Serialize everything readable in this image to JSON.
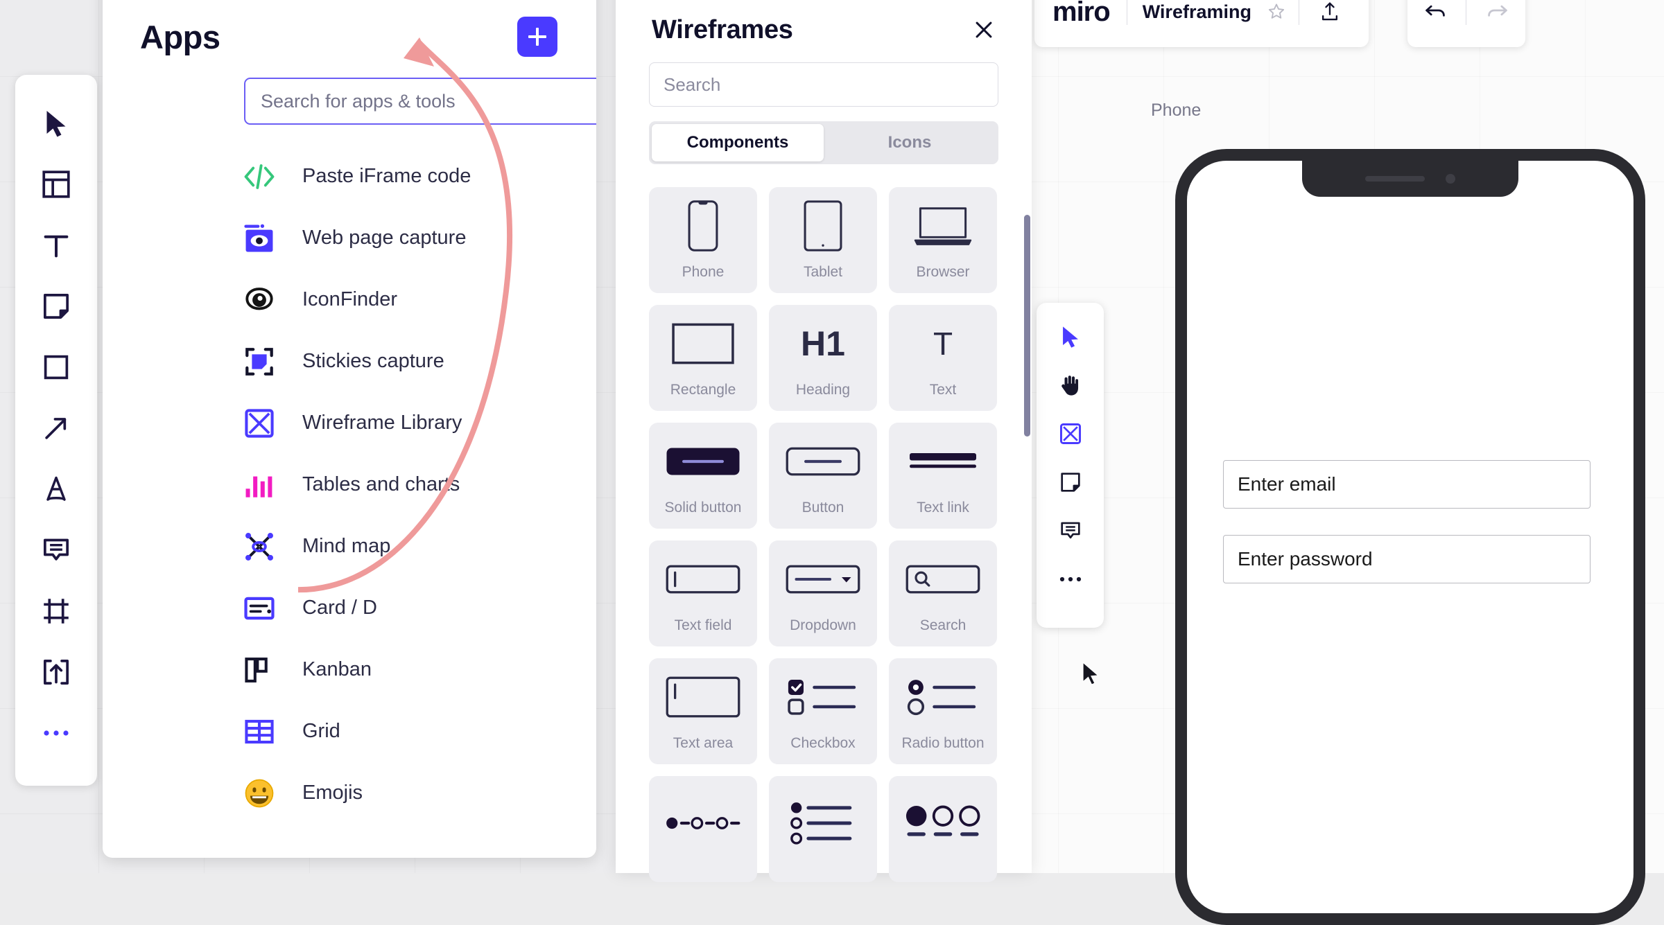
{
  "apps_panel": {
    "title": "Apps",
    "add_button_label": "+",
    "search": {
      "value": "",
      "placeholder": "Search for apps & tools"
    },
    "items": [
      {
        "label": "Paste iFrame code",
        "icon": "code-brackets-icon"
      },
      {
        "label": "Web page capture",
        "icon": "web-capture-icon"
      },
      {
        "label": "IconFinder",
        "icon": "iconfinder-icon"
      },
      {
        "label": "Stickies capture",
        "icon": "stickies-capture-icon"
      },
      {
        "label": "Wireframe Library",
        "icon": "wireframe-library-icon"
      },
      {
        "label": "Tables and charts",
        "icon": "bar-chart-icon"
      },
      {
        "label": "Mind map",
        "icon": "mind-map-icon"
      },
      {
        "label": "Card / D",
        "icon": "card-icon"
      },
      {
        "label": "Kanban",
        "icon": "kanban-icon"
      },
      {
        "label": "Grid",
        "icon": "grid-icon"
      },
      {
        "label": "Emojis",
        "icon": "emoji-icon"
      }
    ]
  },
  "wireframes_panel": {
    "title": "Wireframes",
    "close_label": "×",
    "search": {
      "value": "",
      "placeholder": "Search"
    },
    "tabs": [
      {
        "label": "Components",
        "active": true
      },
      {
        "label": "Icons",
        "active": false
      }
    ],
    "components": [
      {
        "label": "Phone",
        "art": "phone"
      },
      {
        "label": "Tablet",
        "art": "tablet"
      },
      {
        "label": "Browser",
        "art": "browser"
      },
      {
        "label": "Rectangle",
        "art": "rectangle"
      },
      {
        "label": "Heading",
        "art": "heading",
        "glyph": "H1"
      },
      {
        "label": "Text",
        "art": "text",
        "glyph": "T"
      },
      {
        "label": "Solid button",
        "art": "solid-button"
      },
      {
        "label": "Button",
        "art": "button"
      },
      {
        "label": "Text link",
        "art": "text-link"
      },
      {
        "label": "Text field",
        "art": "text-field"
      },
      {
        "label": "Dropdown",
        "art": "dropdown"
      },
      {
        "label": "Search",
        "art": "search"
      },
      {
        "label": "Text area",
        "art": "text-area"
      },
      {
        "label": "Checkbox",
        "art": "checkbox"
      },
      {
        "label": "Radio button",
        "art": "radio-button"
      },
      {
        "label": "",
        "art": "stepper"
      },
      {
        "label": "",
        "art": "list"
      },
      {
        "label": "",
        "art": "pagination"
      }
    ]
  },
  "left_toolbar": {
    "items": [
      {
        "name": "cursor-icon"
      },
      {
        "name": "templates-icon"
      },
      {
        "name": "text-icon"
      },
      {
        "name": "sticky-note-icon"
      },
      {
        "name": "shapes-icon"
      },
      {
        "name": "arrow-connector-icon"
      },
      {
        "name": "pen-icon"
      },
      {
        "name": "comment-icon"
      },
      {
        "name": "frame-icon"
      },
      {
        "name": "upload-icon"
      },
      {
        "name": "more-icon"
      }
    ]
  },
  "mini_toolbar": {
    "items": [
      {
        "name": "cursor-icon",
        "active": false
      },
      {
        "name": "hand-icon",
        "active": false
      },
      {
        "name": "wireframe-library-icon",
        "active": true
      },
      {
        "name": "sticky-note-icon",
        "active": false
      },
      {
        "name": "comment-icon",
        "active": false
      },
      {
        "name": "more-icon",
        "active": false
      }
    ]
  },
  "top_bar": {
    "logo": "miro",
    "board_name": "Wireframing",
    "star_label": "☆",
    "share_icon": "share-upload-icon",
    "undo_icon": "undo-icon",
    "redo_icon": "redo-icon"
  },
  "canvas": {
    "frame_label": "Phone",
    "phone": {
      "email_field": "Enter email",
      "password_field": "Enter password"
    }
  },
  "colors": {
    "accent_purple": "#4a3aff",
    "ink": "#10102a",
    "annotation_pink": "#ef9a9a",
    "panel_gray": "#eeeef2",
    "canvas_gray": "#ececee"
  }
}
